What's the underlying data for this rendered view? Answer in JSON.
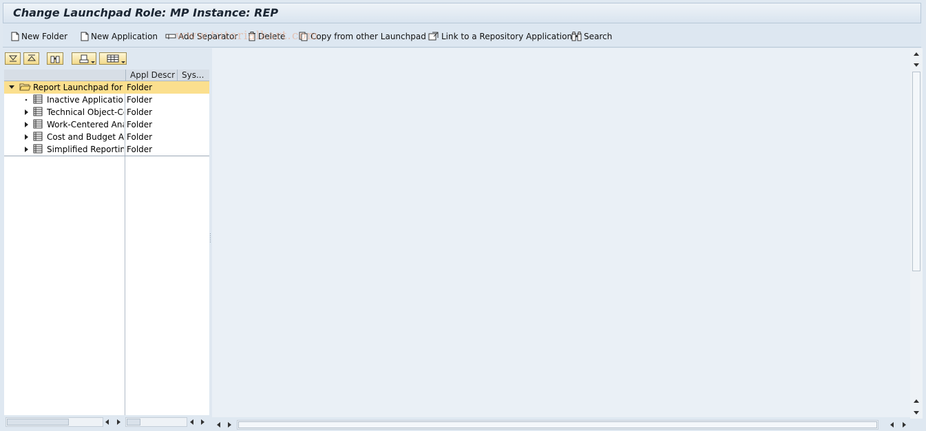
{
  "window": {
    "title": "Change Launchpad Role: MP Instance: REP"
  },
  "watermark": "www.tutorialkart.com",
  "toolbar": {
    "new_folder": "New Folder",
    "new_application": "New Application",
    "add_separator": "Add Separator",
    "delete": "Delete",
    "copy_launchpad": "Copy from other Launchpad",
    "link_repository": "Link to a Repository Application",
    "search": "Search"
  },
  "tree_toolbar": {
    "icons": [
      "expand-all-icon",
      "collapse-all-icon",
      "find-icon",
      "print-icon",
      "layout-icon"
    ]
  },
  "tree": {
    "columns": [
      "Appl Descr",
      "Sys..."
    ],
    "root": {
      "label": "Report Launchpad for M",
      "type": "Folder"
    },
    "items": [
      {
        "label": "Inactive Applications",
        "type": "Folder",
        "expandable": false
      },
      {
        "label": "Technical Object-Cer",
        "type": "Folder",
        "expandable": true
      },
      {
        "label": "Work-Centered Anal",
        "type": "Folder",
        "expandable": true
      },
      {
        "label": "Cost and Budget Ana",
        "type": "Folder",
        "expandable": true
      },
      {
        "label": "Simplified Reporting",
        "type": "Folder",
        "expandable": true
      }
    ]
  },
  "colors": {
    "selected_row": "#fbdf8e",
    "background": "#dfe8f1",
    "content_area": "#eaf0f6"
  }
}
